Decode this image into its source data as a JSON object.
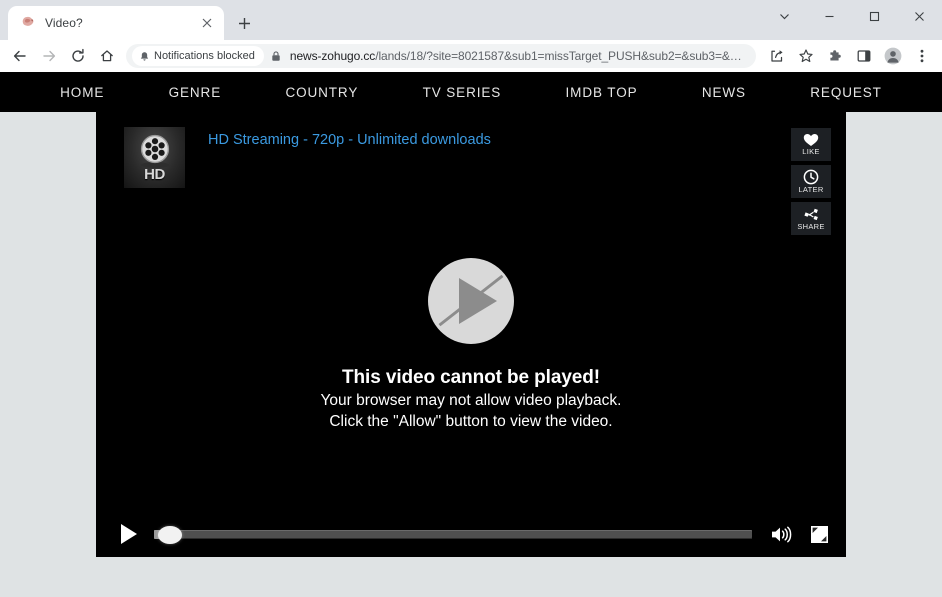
{
  "browser": {
    "tab": {
      "title": "Video?",
      "favicon_name": "site-favicon",
      "close_label": "×"
    },
    "new_tab_label": "+",
    "window_controls": {
      "tab_search": "tab-search-chevron",
      "minimize": "–",
      "maximize": "□",
      "close": "✕"
    },
    "toolbar": {
      "back": "back-arrow",
      "forward": "forward-arrow",
      "reload": "reload-arrow",
      "home": "home-house",
      "permission_chip": {
        "icon": "bell-icon",
        "label": "Notifications blocked"
      },
      "lock_icon": "padlock-icon",
      "url_host": "news-zohugo.cc",
      "url_path": "/lands/18/?site=8021587&sub1=missTarget_PUSH&sub2=&sub3=&…",
      "share": "share-icon",
      "bookmark": "star-icon",
      "extensions": "puzzle-icon",
      "side_panel": "side-panel-icon",
      "profile": "profile-avatar-icon",
      "menu": "three-dot-menu-icon"
    }
  },
  "site": {
    "nav": [
      {
        "label": "HOME"
      },
      {
        "label": "GENRE"
      },
      {
        "label": "COUNTRY"
      },
      {
        "label": "TV SERIES"
      },
      {
        "label": "IMDB TOP"
      },
      {
        "label": "NEWS"
      },
      {
        "label": "REQUEST"
      }
    ]
  },
  "player": {
    "thumbnail": {
      "icon": "film-reel-icon",
      "badge": "HD"
    },
    "title": "HD Streaming - 720p - Unlimited downloads",
    "title_color": "#3b9ae1",
    "side_buttons": [
      {
        "label": "LIKE",
        "icon": "heart-icon"
      },
      {
        "label": "LATER",
        "icon": "clock-icon"
      },
      {
        "label": "SHARE",
        "icon": "share-nodes-icon"
      }
    ],
    "overlay": {
      "play_icon": "play-blocked-icon",
      "heading": "This video cannot be played!",
      "line2": "Your browser may not allow video playback.",
      "line3": "Click the \"Allow\" button to view the video."
    },
    "controls": {
      "play": "play-icon",
      "progress_percent": 2,
      "volume": "volume-icon",
      "fullscreen": "fullscreen-icon"
    }
  },
  "colors": {
    "page_background": "#dfe3e4",
    "nav_background": "#000000",
    "player_background": "#000000",
    "link_blue": "#3b9ae1",
    "chrome_tabstrip": "#dee1e6"
  }
}
